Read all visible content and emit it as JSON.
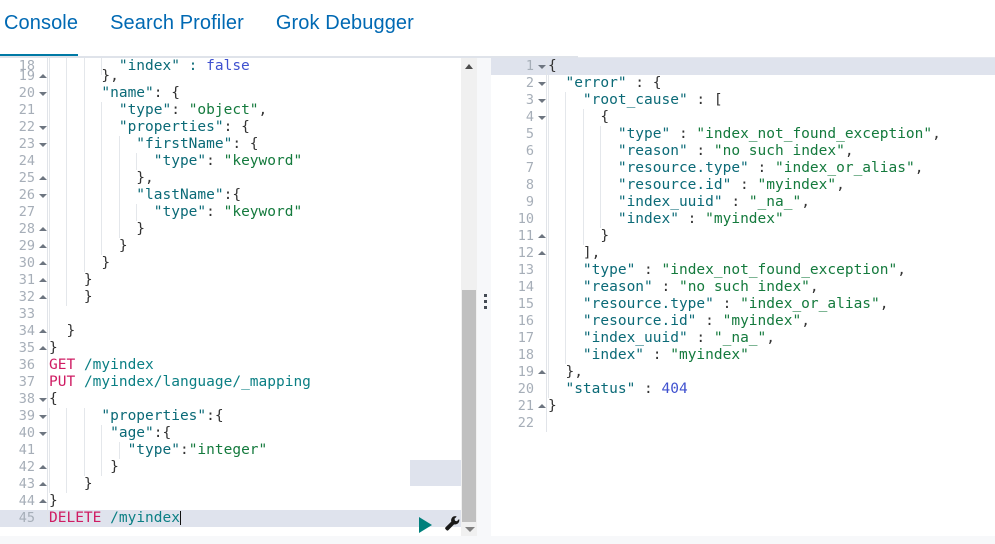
{
  "tabs": [
    {
      "label": "Console",
      "active": true
    },
    {
      "label": "Search Profiler",
      "active": false
    },
    {
      "label": "Grok Debugger",
      "active": false
    }
  ],
  "colors": {
    "accent": "#0079a5",
    "tab_text": "#0069b3",
    "active_line": "#dfe3ed",
    "json_key": "#0b6a77",
    "json_string": "#147a3d",
    "json_number": "#3f51cf",
    "http_method": "#cf1c63",
    "url_path": "#0b7f84",
    "play_button": "#00807c",
    "gutter_text": "#a6aeb8"
  },
  "editor": {
    "name": "request-editor",
    "first_visible_line": 18,
    "active_line": 45,
    "cursor_line": 45,
    "lines": [
      {
        "num": "18",
        "fold": "",
        "indent": 4,
        "clipped": true,
        "tokens": [
          {
            "t": "        \"index\" : ",
            "c": "k"
          },
          {
            "t": "false",
            "c": "n"
          }
        ]
      },
      {
        "num": "19",
        "fold": "up",
        "indent": 3,
        "tokens": [
          {
            "t": "      },",
            "c": "p"
          }
        ]
      },
      {
        "num": "20",
        "fold": "down",
        "indent": 3,
        "tokens": [
          {
            "t": "      \"name\"",
            "c": "k"
          },
          {
            "t": ": {",
            "c": "p"
          }
        ]
      },
      {
        "num": "21",
        "fold": "",
        "indent": 4,
        "tokens": [
          {
            "t": "        \"type\"",
            "c": "k"
          },
          {
            "t": ": ",
            "c": "p"
          },
          {
            "t": "\"object\"",
            "c": "s"
          },
          {
            "t": ",",
            "c": "p"
          }
        ]
      },
      {
        "num": "22",
        "fold": "down",
        "indent": 4,
        "tokens": [
          {
            "t": "        \"properties\"",
            "c": "k"
          },
          {
            "t": ": {",
            "c": "p"
          }
        ]
      },
      {
        "num": "23",
        "fold": "down",
        "indent": 5,
        "tokens": [
          {
            "t": "          \"firstName\"",
            "c": "k"
          },
          {
            "t": ": {",
            "c": "p"
          }
        ]
      },
      {
        "num": "24",
        "fold": "",
        "indent": 6,
        "tokens": [
          {
            "t": "            \"type\"",
            "c": "k"
          },
          {
            "t": ": ",
            "c": "p"
          },
          {
            "t": "\"keyword\"",
            "c": "s"
          }
        ]
      },
      {
        "num": "25",
        "fold": "up",
        "indent": 5,
        "tokens": [
          {
            "t": "          },",
            "c": "p"
          }
        ]
      },
      {
        "num": "26",
        "fold": "down",
        "indent": 5,
        "tokens": [
          {
            "t": "          \"lastName\"",
            "c": "k"
          },
          {
            "t": ":{",
            "c": "p"
          }
        ]
      },
      {
        "num": "27",
        "fold": "",
        "indent": 6,
        "tokens": [
          {
            "t": "            \"type\"",
            "c": "k"
          },
          {
            "t": ": ",
            "c": "p"
          },
          {
            "t": "\"keyword\"",
            "c": "s"
          }
        ]
      },
      {
        "num": "28",
        "fold": "up",
        "indent": 5,
        "tokens": [
          {
            "t": "          }",
            "c": "p"
          }
        ]
      },
      {
        "num": "29",
        "fold": "up",
        "indent": 4,
        "tokens": [
          {
            "t": "        }",
            "c": "p"
          }
        ]
      },
      {
        "num": "30",
        "fold": "up",
        "indent": 3,
        "tokens": [
          {
            "t": "      }",
            "c": "p"
          }
        ]
      },
      {
        "num": "31",
        "fold": "up",
        "indent": 2,
        "tokens": [
          {
            "t": "    }",
            "c": "p"
          }
        ]
      },
      {
        "num": "32",
        "fold": "up",
        "indent": 2,
        "tokens": [
          {
            "t": "    }",
            "c": "p"
          }
        ]
      },
      {
        "num": "33",
        "fold": "",
        "indent": 1,
        "tokens": []
      },
      {
        "num": "34",
        "fold": "up",
        "indent": 1,
        "tokens": [
          {
            "t": "  }",
            "c": "p"
          }
        ]
      },
      {
        "num": "35",
        "fold": "up",
        "indent": 0,
        "tokens": [
          {
            "t": "}",
            "c": "p"
          }
        ]
      },
      {
        "num": "36",
        "fold": "",
        "indent": 0,
        "tokens": [
          {
            "t": "GET",
            "c": "m"
          },
          {
            "t": " ",
            "c": "p"
          },
          {
            "t": "/myindex",
            "c": "u"
          }
        ]
      },
      {
        "num": "37",
        "fold": "",
        "indent": 0,
        "tokens": [
          {
            "t": "PUT",
            "c": "m"
          },
          {
            "t": " ",
            "c": "p"
          },
          {
            "t": "/myindex/language/_mapping",
            "c": "u"
          }
        ]
      },
      {
        "num": "38",
        "fold": "down",
        "indent": 0,
        "tokens": [
          {
            "t": "{",
            "c": "p"
          }
        ]
      },
      {
        "num": "39",
        "fold": "down",
        "indent": 3,
        "tokens": [
          {
            "t": "      \"properties\"",
            "c": "k"
          },
          {
            "t": ":{",
            "c": "p"
          }
        ]
      },
      {
        "num": "40",
        "fold": "down",
        "indent": 4,
        "tokens": [
          {
            "t": "       \"age\"",
            "c": "k"
          },
          {
            "t": ":{",
            "c": "p"
          }
        ]
      },
      {
        "num": "41",
        "fold": "",
        "indent": 5,
        "tokens": [
          {
            "t": "         \"type\"",
            "c": "k"
          },
          {
            "t": ":",
            "c": "p"
          },
          {
            "t": "\"integer\"",
            "c": "s"
          }
        ]
      },
      {
        "num": "42",
        "fold": "up",
        "indent": 4,
        "tokens": [
          {
            "t": "       }",
            "c": "p"
          }
        ]
      },
      {
        "num": "43",
        "fold": "up",
        "indent": 2,
        "tokens": [
          {
            "t": "    }",
            "c": "p"
          }
        ]
      },
      {
        "num": "44",
        "fold": "up",
        "indent": 0,
        "tokens": [
          {
            "t": "}",
            "c": "p"
          }
        ]
      },
      {
        "num": "45",
        "fold": "",
        "indent": 0,
        "active": true,
        "caret": true,
        "tokens": [
          {
            "t": "DELETE",
            "c": "m"
          },
          {
            "t": " ",
            "c": "p"
          },
          {
            "t": "/myindex",
            "c": "u"
          }
        ]
      }
    ]
  },
  "response": {
    "name": "response-viewer",
    "active_line": 1,
    "lines": [
      {
        "num": "1",
        "fold": "down",
        "indent": 0,
        "active": true,
        "tokens": [
          {
            "t": "{",
            "c": "p"
          }
        ]
      },
      {
        "num": "2",
        "fold": "down",
        "indent": 1,
        "tokens": [
          {
            "t": "  \"error\"",
            "c": "k"
          },
          {
            "t": " : {",
            "c": "p"
          }
        ]
      },
      {
        "num": "3",
        "fold": "down",
        "indent": 2,
        "tokens": [
          {
            "t": "    \"root_cause\"",
            "c": "k"
          },
          {
            "t": " : [",
            "c": "p"
          }
        ]
      },
      {
        "num": "4",
        "fold": "down",
        "indent": 3,
        "tokens": [
          {
            "t": "      {",
            "c": "p"
          }
        ]
      },
      {
        "num": "5",
        "fold": "",
        "indent": 4,
        "tokens": [
          {
            "t": "        \"type\"",
            "c": "k"
          },
          {
            "t": " : ",
            "c": "p"
          },
          {
            "t": "\"index_not_found_exception\"",
            "c": "s"
          },
          {
            "t": ",",
            "c": "p"
          }
        ]
      },
      {
        "num": "6",
        "fold": "",
        "indent": 4,
        "tokens": [
          {
            "t": "        \"reason\"",
            "c": "k"
          },
          {
            "t": " : ",
            "c": "p"
          },
          {
            "t": "\"no such index\"",
            "c": "s"
          },
          {
            "t": ",",
            "c": "p"
          }
        ]
      },
      {
        "num": "7",
        "fold": "",
        "indent": 4,
        "tokens": [
          {
            "t": "        \"resource.type\"",
            "c": "k"
          },
          {
            "t": " : ",
            "c": "p"
          },
          {
            "t": "\"index_or_alias\"",
            "c": "s"
          },
          {
            "t": ",",
            "c": "p"
          }
        ]
      },
      {
        "num": "8",
        "fold": "",
        "indent": 4,
        "tokens": [
          {
            "t": "        \"resource.id\"",
            "c": "k"
          },
          {
            "t": " : ",
            "c": "p"
          },
          {
            "t": "\"myindex\"",
            "c": "s"
          },
          {
            "t": ",",
            "c": "p"
          }
        ]
      },
      {
        "num": "9",
        "fold": "",
        "indent": 4,
        "tokens": [
          {
            "t": "        \"index_uuid\"",
            "c": "k"
          },
          {
            "t": " : ",
            "c": "p"
          },
          {
            "t": "\"_na_\"",
            "c": "s"
          },
          {
            "t": ",",
            "c": "p"
          }
        ]
      },
      {
        "num": "10",
        "fold": "",
        "indent": 4,
        "tokens": [
          {
            "t": "        \"index\"",
            "c": "k"
          },
          {
            "t": " : ",
            "c": "p"
          },
          {
            "t": "\"myindex\"",
            "c": "s"
          }
        ]
      },
      {
        "num": "11",
        "fold": "up",
        "indent": 3,
        "tokens": [
          {
            "t": "      }",
            "c": "p"
          }
        ]
      },
      {
        "num": "12",
        "fold": "up",
        "indent": 2,
        "tokens": [
          {
            "t": "    ],",
            "c": "p"
          }
        ]
      },
      {
        "num": "13",
        "fold": "",
        "indent": 2,
        "tokens": [
          {
            "t": "    \"type\"",
            "c": "k"
          },
          {
            "t": " : ",
            "c": "p"
          },
          {
            "t": "\"index_not_found_exception\"",
            "c": "s"
          },
          {
            "t": ",",
            "c": "p"
          }
        ]
      },
      {
        "num": "14",
        "fold": "",
        "indent": 2,
        "tokens": [
          {
            "t": "    \"reason\"",
            "c": "k"
          },
          {
            "t": " : ",
            "c": "p"
          },
          {
            "t": "\"no such index\"",
            "c": "s"
          },
          {
            "t": ",",
            "c": "p"
          }
        ]
      },
      {
        "num": "15",
        "fold": "",
        "indent": 2,
        "tokens": [
          {
            "t": "    \"resource.type\"",
            "c": "k"
          },
          {
            "t": " : ",
            "c": "p"
          },
          {
            "t": "\"index_or_alias\"",
            "c": "s"
          },
          {
            "t": ",",
            "c": "p"
          }
        ]
      },
      {
        "num": "16",
        "fold": "",
        "indent": 2,
        "tokens": [
          {
            "t": "    \"resource.id\"",
            "c": "k"
          },
          {
            "t": " : ",
            "c": "p"
          },
          {
            "t": "\"myindex\"",
            "c": "s"
          },
          {
            "t": ",",
            "c": "p"
          }
        ]
      },
      {
        "num": "17",
        "fold": "",
        "indent": 2,
        "tokens": [
          {
            "t": "    \"index_uuid\"",
            "c": "k"
          },
          {
            "t": " : ",
            "c": "p"
          },
          {
            "t": "\"_na_\"",
            "c": "s"
          },
          {
            "t": ",",
            "c": "p"
          }
        ]
      },
      {
        "num": "18",
        "fold": "",
        "indent": 2,
        "tokens": [
          {
            "t": "    \"index\"",
            "c": "k"
          },
          {
            "t": " : ",
            "c": "p"
          },
          {
            "t": "\"myindex\"",
            "c": "s"
          }
        ]
      },
      {
        "num": "19",
        "fold": "up",
        "indent": 1,
        "tokens": [
          {
            "t": "  },",
            "c": "p"
          }
        ]
      },
      {
        "num": "20",
        "fold": "",
        "indent": 1,
        "tokens": [
          {
            "t": "  \"status\"",
            "c": "k"
          },
          {
            "t": " : ",
            "c": "p"
          },
          {
            "t": "404",
            "c": "n"
          }
        ]
      },
      {
        "num": "21",
        "fold": "up",
        "indent": 0,
        "tokens": [
          {
            "t": "}",
            "c": "p"
          }
        ]
      },
      {
        "num": "22",
        "fold": "",
        "indent": 0,
        "tokens": []
      }
    ]
  },
  "controls": {
    "play_button": "send-request",
    "wrench_button": "request-options",
    "scroll_up": "scroll-up",
    "scroll_down": "scroll-down",
    "drag_handle": "pane-resize-handle"
  }
}
